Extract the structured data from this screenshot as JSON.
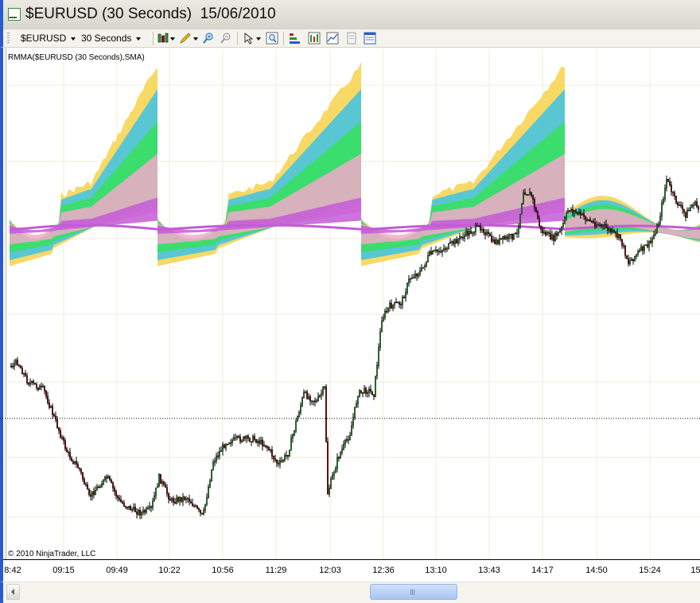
{
  "window": {
    "title": "$EURUSD (30 Seconds)  15/06/2010"
  },
  "toolbar": {
    "instrument": "$EURUSD",
    "interval": "30 Seconds",
    "icons": [
      "chart-style-icon",
      "drawing-pencil-icon",
      "zoom-in-icon",
      "zoom-out-icon",
      "cursor-icon",
      "magnifier-icon",
      "indicators-icon",
      "strategies-icon",
      "chart-properties-icon",
      "templates-icon",
      "data-box-icon"
    ]
  },
  "chart": {
    "indicator_label": "RMMA($EURUSD (30 Seconds),SMA)",
    "copyright": "© 2010 NinjaTrader, LLC",
    "time_ticks": [
      "8:42",
      "09:15",
      "09:49",
      "10:22",
      "10:56",
      "11:29",
      "12:03",
      "12:36",
      "13:10",
      "13:43",
      "14:17",
      "14:50",
      "15:24",
      "15:"
    ],
    "colors": {
      "background": "#ffffff",
      "gridline": "#f0ecd8",
      "candle_up": "#3c9c3c",
      "candle_down": "#8b1010",
      "candle_outline": "#000000",
      "rmma_fast": "#f7d24a",
      "rmma_mid": "#3cc3e6",
      "rmma_green": "#36e05a",
      "rmma_pink": "#f3a9c9",
      "rmma_slow": "#c45bd8",
      "window_border": "#2a5ad0"
    }
  }
}
